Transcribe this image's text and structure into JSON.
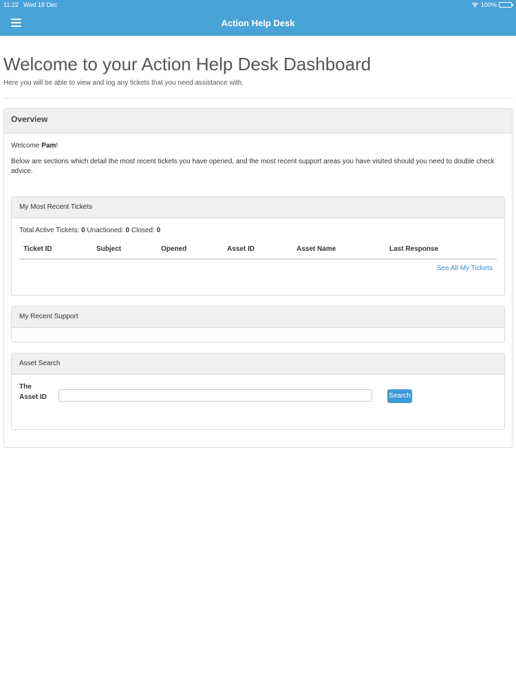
{
  "status_bar": {
    "time": "11:22",
    "date": "Wed 18 Dec",
    "battery": "100%"
  },
  "header": {
    "title": "Action Help Desk",
    "menu_icon": "hamburger-menu-icon"
  },
  "page": {
    "title": "Welcome to your Action Help Desk Dashboard",
    "subtitle": "Here you will be able to view and log any tickets that you need assistance with."
  },
  "overview": {
    "heading": "Overview",
    "welcome_prefix": "Welcome ",
    "user_name": "Pam",
    "welcome_suffix": "!",
    "intro": "Below are sections which detail the most recent tickets you have opened, and the most recent support areas you have visited should you need to double check advice."
  },
  "tickets": {
    "heading": "My Most Recent Tickets",
    "total_label": "Total Active Tickets: ",
    "total_value": "0",
    "unactioned_label": " Unactioned: ",
    "unactioned_value": "0",
    "closed_label": " Closed: ",
    "closed_value": "0",
    "columns": [
      "Ticket ID",
      "Subject",
      "Opened",
      "Asset ID",
      "Asset Name",
      "Last Response"
    ],
    "rows": [],
    "see_all": "See All My Tickets"
  },
  "support": {
    "heading": "My Recent Support"
  },
  "asset_search": {
    "heading": "Asset Search",
    "label": "The Asset ID",
    "input_value": "",
    "button": "Search"
  }
}
